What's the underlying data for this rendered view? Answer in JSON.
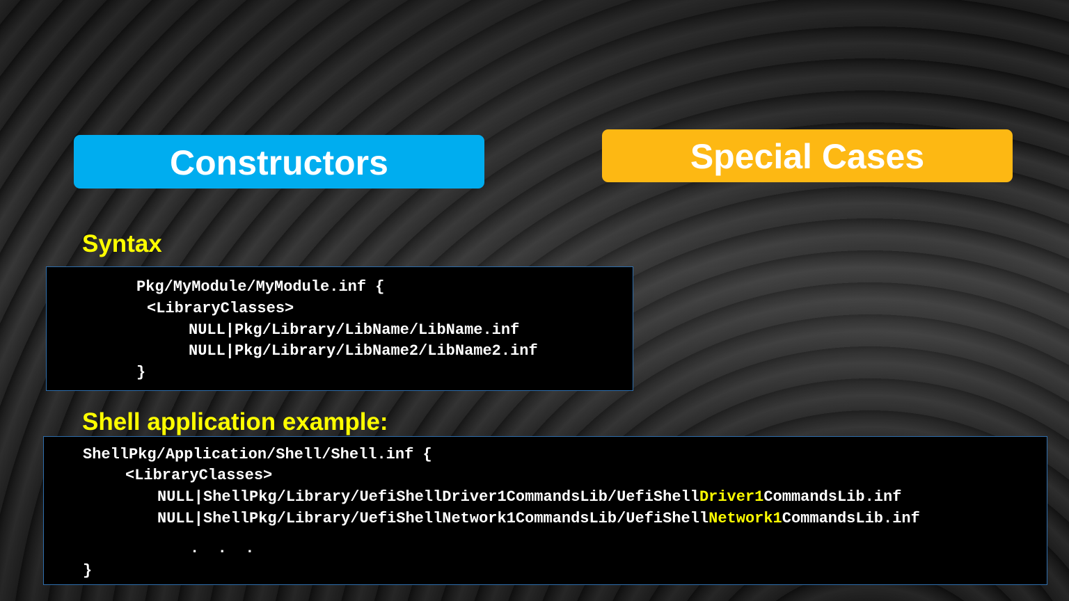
{
  "buttons": {
    "constructors": "Constructors",
    "special_cases": "Special Cases"
  },
  "syntax": {
    "heading": "Syntax",
    "lines": [
      "Pkg/MyModule/MyModule.inf {",
      "<LibraryClasses>",
      "NULL|Pkg/Library/LibName/LibName.inf",
      "NULL|Pkg/Library/LibName2/LibName2.inf",
      "}"
    ]
  },
  "shell_example": {
    "heading": "Shell application example:",
    "line1": "ShellPkg/Application/Shell/Shell.inf {",
    "line2": "<LibraryClasses>",
    "line3": {
      "pre": "NULL|ShellPkg/Library/UefiShellDriver1CommandsLib/UefiShell",
      "highlight": "Driver1",
      "post": "CommandsLib.inf"
    },
    "line4": {
      "pre": "NULL|ShellPkg/Library/UefiShellNetwork1CommandsLib/UefiShell",
      "highlight": "Network1",
      "post": "CommandsLib.inf"
    },
    "ellipsis": ".  .  .",
    "closing": "}"
  },
  "colors": {
    "constructors_pill": "#00adef",
    "special_cases_pill": "#fdb813",
    "heading": "#ffff00",
    "code_highlight": "#ffff00",
    "code_text": "#ffffff",
    "code_background": "#000000"
  }
}
